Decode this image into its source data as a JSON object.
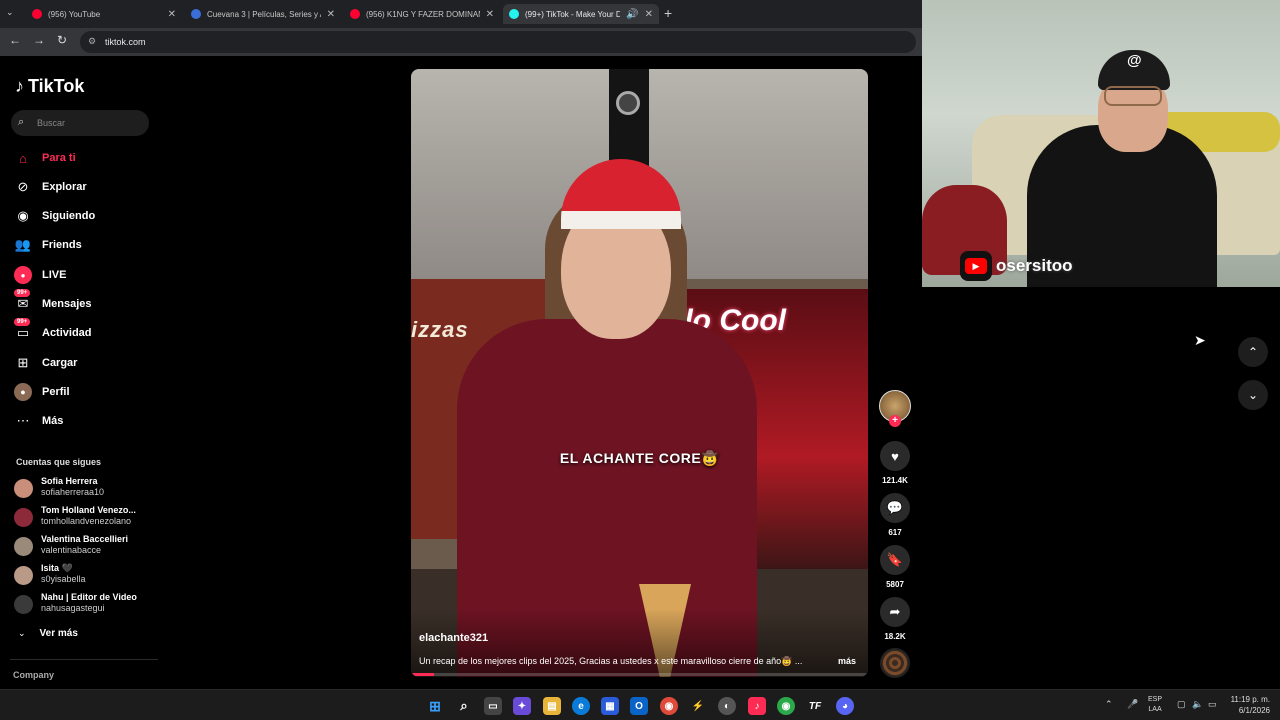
{
  "browser": {
    "tabs": [
      {
        "title": "(956) YouTube",
        "color": "#ff0033",
        "active": false
      },
      {
        "title": "Cuevana 3 | Películas, Series y A",
        "color": "#3b6fd8",
        "active": false
      },
      {
        "title": "(956) K1NG Y FAZER DOMINAN",
        "color": "#ff0033",
        "active": false
      },
      {
        "title": "(99+) TikTok - Make Your Da",
        "color": "#25f4ee",
        "active": true
      }
    ],
    "url": "tiktok.com"
  },
  "tiktok": {
    "logo": "TikTok",
    "search_placeholder": "Buscar",
    "nav": [
      {
        "label": "Para ti",
        "icon": "home-icon",
        "active": true
      },
      {
        "label": "Explorar",
        "icon": "compass-icon",
        "active": false
      },
      {
        "label": "Siguiendo",
        "icon": "following-icon",
        "active": false
      },
      {
        "label": "Friends",
        "icon": "friends-icon",
        "active": false
      },
      {
        "label": "LIVE",
        "icon": "live-icon",
        "active": false
      },
      {
        "label": "Mensajes",
        "icon": "messages-icon",
        "active": false,
        "badge": "99+"
      },
      {
        "label": "Actividad",
        "icon": "activity-icon",
        "active": false,
        "badge": "99+"
      },
      {
        "label": "Cargar",
        "icon": "upload-icon",
        "active": false
      },
      {
        "label": "Perfil",
        "icon": "profile-icon",
        "active": false
      },
      {
        "label": "Más",
        "icon": "more-icon",
        "active": false
      }
    ],
    "following_title": "Cuentas que sigues",
    "following": [
      {
        "name": "Sofia Herrera",
        "handle": "sofiaherreraa10"
      },
      {
        "name": "Tom Holland Venezo...",
        "handle": "tomhollandvenezolano"
      },
      {
        "name": "Valentina Baccellieri",
        "handle": "valentinabacce"
      },
      {
        "name": "Isita 🖤",
        "handle": "s0yisabella"
      },
      {
        "name": "Nahu | Editor de Video",
        "handle": "nahusagastegui"
      }
    ],
    "see_more": "Ver más",
    "company": "Company"
  },
  "video": {
    "overlay_text": "EL ACHANTE CORE🤠",
    "sign_left": "izzas",
    "sign_right": "llo Cool",
    "author": "elachante321",
    "caption": "Un recap de los mejores clips del 2025, Gracias a ustedes x este maravilloso cierre de año🤠 ...",
    "more": "más",
    "progress": 0.05,
    "likes": "121.4K",
    "comments": "617",
    "saves": "5807",
    "shares": "18.2K"
  },
  "webcam": {
    "channel": "osersitoo"
  },
  "taskbar": {
    "lang_top": "ESP",
    "lang_bottom": "LAA",
    "time": "11:19 p. m.",
    "date": "6/1/2026"
  },
  "colors": {
    "accent": "#fe2c55",
    "background": "#000000"
  }
}
